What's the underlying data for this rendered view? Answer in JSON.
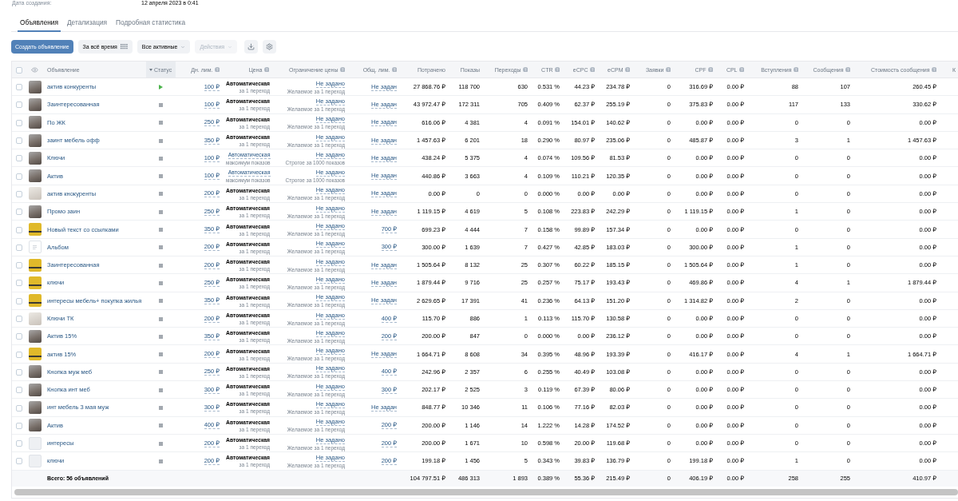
{
  "meta": {
    "label": "Дата создания:",
    "value": "12 апреля 2023 в 0:41"
  },
  "tabs": [
    {
      "label": "Объявления",
      "selected": true
    },
    {
      "label": "Детализация",
      "selected": false
    },
    {
      "label": "Подробная статистика",
      "selected": false
    }
  ],
  "toolbar": {
    "create_button": "Создать объявление",
    "period": "За всё время",
    "filter": "Все активные",
    "actions": {
      "label": "Действия",
      "disabled": true
    }
  },
  "table": {
    "select_all": {
      "checked": false
    },
    "columns": [
      {
        "label": "Объявление",
        "help": false,
        "sorted": false
      },
      {
        "label": "Статус",
        "help": false,
        "sorted": true
      },
      {
        "label": "Дн. лим.",
        "help": true,
        "sorted": false
      },
      {
        "label": "Цена",
        "help": true,
        "sorted": false
      },
      {
        "label": "Ограничение цены",
        "help": true,
        "sorted": false
      },
      {
        "label": "Общ. лим.",
        "help": true,
        "sorted": false
      },
      {
        "label": "Потрачено",
        "help": false,
        "sorted": false
      },
      {
        "label": "Показы",
        "help": false,
        "sorted": false
      },
      {
        "label": "Переходы",
        "help": true,
        "sorted": false
      },
      {
        "label": "CTR",
        "help": true,
        "sorted": false
      },
      {
        "label": "eCPC",
        "help": true,
        "sorted": false
      },
      {
        "label": "eCPM",
        "help": true,
        "sorted": false
      },
      {
        "label": "Заявки",
        "help": true,
        "sorted": false
      },
      {
        "label": "CPF",
        "help": true,
        "sorted": false
      },
      {
        "label": "CPL",
        "help": true,
        "sorted": false
      },
      {
        "label": "Вступления",
        "help": true,
        "sorted": false
      },
      {
        "label": "Сообщения",
        "help": true,
        "sorted": false
      },
      {
        "label": "Стоимость сообщения",
        "help": true,
        "sorted": false
      },
      {
        "label": "К",
        "help": false,
        "sorted": false
      }
    ],
    "rows": [
      {
        "checked": false,
        "thumbnail": {
          "kind": "photo"
        },
        "name": "актив конкуренты",
        "active": true,
        "day_limit": "100 ₽",
        "price": {
          "text": "Автоматическая",
          "note": "за 1 переход",
          "link": false
        },
        "price_limit": {
          "text": "Не задано",
          "note": "Желаемое за 1 переход"
        },
        "total_limit": "Не задан",
        "stats": [
          "27 868.76 ₽",
          "118 700",
          "630",
          "0.531 %",
          "44.23 ₽",
          "234.78 ₽",
          "0",
          "316.69 ₽",
          "0.00 ₽",
          "88",
          "107",
          "260.45 ₽"
        ]
      },
      {
        "checked": false,
        "thumbnail": {
          "kind": "photo"
        },
        "name": "Заинтересованная",
        "active": false,
        "day_limit": "100 ₽",
        "price": {
          "text": "Автоматическая",
          "note": "за 1 переход",
          "link": false
        },
        "price_limit": {
          "text": "Не задано",
          "note": "Желаемое за 1 переход"
        },
        "total_limit": "Не задан",
        "stats": [
          "43 972.47 ₽",
          "172 311",
          "705",
          "0.409 %",
          "62.37 ₽",
          "255.19 ₽",
          "0",
          "375.83 ₽",
          "0.00 ₽",
          "117",
          "133",
          "330.62 ₽"
        ]
      },
      {
        "checked": false,
        "thumbnail": {
          "kind": "photo"
        },
        "name": "По ЖК",
        "active": false,
        "day_limit": "250 ₽",
        "price": {
          "text": "Автоматическая",
          "note": "за 1 переход",
          "link": false
        },
        "price_limit": {
          "text": "Не задано",
          "note": "Желаемое за 1 переход"
        },
        "total_limit": "Не задан",
        "stats": [
          "616.06 ₽",
          "4 381",
          "4",
          "0.091 %",
          "154.01 ₽",
          "140.62 ₽",
          "0",
          "0.00 ₽",
          "0.00 ₽",
          "0",
          "0",
          "0.00 ₽"
        ]
      },
      {
        "checked": false,
        "thumbnail": {
          "kind": "photo"
        },
        "name": "заинт мебель офф",
        "active": false,
        "day_limit": "350 ₽",
        "price": {
          "text": "Автоматическая",
          "note": "за 1 переход",
          "link": false
        },
        "price_limit": {
          "text": "Не задано",
          "note": "Желаемое за 1 переход"
        },
        "total_limit": "Не задан",
        "stats": [
          "1 457.63 ₽",
          "6 201",
          "18",
          "0.290 %",
          "80.97 ₽",
          "235.06 ₽",
          "0",
          "485.87 ₽",
          "0.00 ₽",
          "3",
          "1",
          "1 457.63 ₽"
        ]
      },
      {
        "checked": false,
        "thumbnail": {
          "kind": "photo"
        },
        "name": "Ключи",
        "active": false,
        "day_limit": "100 ₽",
        "price": {
          "text": "Автоматическая",
          "note": "максимум показов",
          "link": true
        },
        "price_limit": {
          "text": "Не задано",
          "note": "Строгое за 1000 показов"
        },
        "total_limit": "Не задан",
        "stats": [
          "438.24 ₽",
          "5 375",
          "4",
          "0.074 %",
          "109.56 ₽",
          "81.53 ₽",
          "0",
          "0.00 ₽",
          "0.00 ₽",
          "0",
          "0",
          "0.00 ₽"
        ]
      },
      {
        "checked": false,
        "thumbnail": {
          "kind": "photo"
        },
        "name": "Актив",
        "active": false,
        "day_limit": "100 ₽",
        "price": {
          "text": "Автоматическая",
          "note": "максимум показов",
          "link": true
        },
        "price_limit": {
          "text": "Не задано",
          "note": "Строгое за 1000 показов"
        },
        "total_limit": "Не задан",
        "stats": [
          "440.86 ₽",
          "3 663",
          "4",
          "0.109 %",
          "110.21 ₽",
          "120.35 ₽",
          "0",
          "0.00 ₽",
          "0.00 ₽",
          "0",
          "0",
          "0.00 ₽"
        ]
      },
      {
        "checked": false,
        "thumbnail": {
          "kind": "sketch"
        },
        "name": "актив кнокуренты",
        "active": false,
        "day_limit": "200 ₽",
        "price": {
          "text": "Автоматическая",
          "note": "за 1 переход",
          "link": false
        },
        "price_limit": {
          "text": "Не задано",
          "note": "Желаемое за 1 переход"
        },
        "total_limit": "Не задан",
        "stats": [
          "0.00 ₽",
          "0",
          "0",
          "0.000 %",
          "0.00 ₽",
          "0.00 ₽",
          "0",
          "0.00 ₽",
          "0.00 ₽",
          "0",
          "0",
          "0.00 ₽"
        ]
      },
      {
        "checked": false,
        "thumbnail": {
          "kind": "photo"
        },
        "name": "Промо заин",
        "active": false,
        "day_limit": "250 ₽",
        "price": {
          "text": "Автоматическая",
          "note": "за 1 переход",
          "link": false
        },
        "price_limit": {
          "text": "Не задано",
          "note": "Желаемое за 1 переход"
        },
        "total_limit": "Не задан",
        "stats": [
          "1 119.15 ₽",
          "4 619",
          "5",
          "0.108 %",
          "223.83 ₽",
          "242.29 ₽",
          "0",
          "1 119.15 ₽",
          "0.00 ₽",
          "1",
          "0",
          "0.00 ₽"
        ]
      },
      {
        "checked": false,
        "thumbnail": {
          "kind": "banner"
        },
        "name": "Новый текст со ссылками",
        "active": false,
        "day_limit": "350 ₽",
        "price": {
          "text": "Автоматическая",
          "note": "за 1 переход",
          "link": false
        },
        "price_limit": {
          "text": "Не задано",
          "note": "Желаемое за 1 переход"
        },
        "total_limit": "700 ₽",
        "stats": [
          "699.23 ₽",
          "4 444",
          "7",
          "0.158 %",
          "99.89 ₽",
          "157.34 ₽",
          "0",
          "0.00 ₽",
          "0.00 ₽",
          "0",
          "0",
          "0.00 ₽"
        ]
      },
      {
        "checked": false,
        "thumbnail": {
          "kind": "document"
        },
        "name": "Альбом",
        "active": false,
        "day_limit": "200 ₽",
        "price": {
          "text": "Автоматическая",
          "note": "за 1 переход",
          "link": false
        },
        "price_limit": {
          "text": "Не задано",
          "note": "Желаемое за 1 переход"
        },
        "total_limit": "300 ₽",
        "stats": [
          "300.00 ₽",
          "1 639",
          "7",
          "0.427 %",
          "42.85 ₽",
          "183.03 ₽",
          "0",
          "300.00 ₽",
          "0.00 ₽",
          "1",
          "0",
          "0.00 ₽"
        ]
      },
      {
        "checked": false,
        "thumbnail": {
          "kind": "banner"
        },
        "name": "Заинтересованная",
        "active": false,
        "day_limit": "200 ₽",
        "price": {
          "text": "Автоматическая",
          "note": "за 1 переход",
          "link": false
        },
        "price_limit": {
          "text": "Не задано",
          "note": "Желаемое за 1 переход"
        },
        "total_limit": "Не задан",
        "stats": [
          "1 505.64 ₽",
          "8 132",
          "25",
          "0.307 %",
          "60.22 ₽",
          "185.15 ₽",
          "0",
          "1 505.64 ₽",
          "0.00 ₽",
          "1",
          "0",
          "0.00 ₽"
        ]
      },
      {
        "checked": false,
        "thumbnail": {
          "kind": "banner"
        },
        "name": "ключи",
        "active": false,
        "day_limit": "250 ₽",
        "price": {
          "text": "Автоматическая",
          "note": "за 1 переход",
          "link": false
        },
        "price_limit": {
          "text": "Не задано",
          "note": "Желаемое за 1 переход"
        },
        "total_limit": "Не задан",
        "stats": [
          "1 879.44 ₽",
          "9 716",
          "25",
          "0.257 %",
          "75.17 ₽",
          "193.43 ₽",
          "0",
          "469.86 ₽",
          "0.00 ₽",
          "4",
          "1",
          "1 879.44 ₽"
        ]
      },
      {
        "checked": false,
        "thumbnail": {
          "kind": "banner"
        },
        "name": "интересы мебель+ покупка жилья",
        "active": false,
        "day_limit": "350 ₽",
        "price": {
          "text": "Автоматическая",
          "note": "за 1 переход",
          "link": false
        },
        "price_limit": {
          "text": "Не задано",
          "note": "Желаемое за 1 переход"
        },
        "total_limit": "Не задан",
        "stats": [
          "2 629.65 ₽",
          "17 391",
          "41",
          "0.236 %",
          "64.13 ₽",
          "151.20 ₽",
          "0",
          "1 314.82 ₽",
          "0.00 ₽",
          "2",
          "0",
          "0.00 ₽"
        ]
      },
      {
        "checked": false,
        "thumbnail": {
          "kind": "sketch"
        },
        "name": "Ключи ТК",
        "active": false,
        "day_limit": "200 ₽",
        "price": {
          "text": "Автоматическая",
          "note": "за 1 переход",
          "link": false
        },
        "price_limit": {
          "text": "Не задано",
          "note": "Желаемое за 1 переход"
        },
        "total_limit": "400 ₽",
        "stats": [
          "115.70 ₽",
          "886",
          "1",
          "0.113 %",
          "115.70 ₽",
          "130.58 ₽",
          "0",
          "0.00 ₽",
          "0.00 ₽",
          "0",
          "0",
          "0.00 ₽"
        ]
      },
      {
        "checked": false,
        "thumbnail": {
          "kind": "photo"
        },
        "name": "Актив 15%",
        "active": false,
        "day_limit": "350 ₽",
        "price": {
          "text": "Автоматическая",
          "note": "за 1 переход",
          "link": false
        },
        "price_limit": {
          "text": "Не задано",
          "note": "Желаемое за 1 переход"
        },
        "total_limit": "200 ₽",
        "stats": [
          "200.00 ₽",
          "847",
          "0",
          "0.000 %",
          "0.00 ₽",
          "236.12 ₽",
          "0",
          "0.00 ₽",
          "0.00 ₽",
          "0",
          "0",
          "0.00 ₽"
        ]
      },
      {
        "checked": false,
        "thumbnail": {
          "kind": "banner"
        },
        "name": "актив 15%",
        "active": false,
        "day_limit": "200 ₽",
        "price": {
          "text": "Автоматическая",
          "note": "за 1 переход",
          "link": false
        },
        "price_limit": {
          "text": "Не задано",
          "note": "Желаемое за 1 переход"
        },
        "total_limit": "Не задан",
        "stats": [
          "1 664.71 ₽",
          "8 608",
          "34",
          "0.395 %",
          "48.96 ₽",
          "193.39 ₽",
          "0",
          "416.17 ₽",
          "0.00 ₽",
          "4",
          "1",
          "1 664.71 ₽"
        ]
      },
      {
        "checked": false,
        "thumbnail": {
          "kind": "photo"
        },
        "name": "Кнопка муж меб",
        "active": false,
        "day_limit": "250 ₽",
        "price": {
          "text": "Автоматическая",
          "note": "за 1 переход",
          "link": false
        },
        "price_limit": {
          "text": "Не задано",
          "note": "Желаемое за 1 переход"
        },
        "total_limit": "400 ₽",
        "stats": [
          "242.96 ₽",
          "2 357",
          "6",
          "0.255 %",
          "40.49 ₽",
          "103.08 ₽",
          "0",
          "0.00 ₽",
          "0.00 ₽",
          "0",
          "0",
          "0.00 ₽"
        ]
      },
      {
        "checked": false,
        "thumbnail": {
          "kind": "photo"
        },
        "name": "Кнопка инт меб",
        "active": false,
        "day_limit": "300 ₽",
        "price": {
          "text": "Автоматическая",
          "note": "за 1 переход",
          "link": false
        },
        "price_limit": {
          "text": "Не задано",
          "note": "Желаемое за 1 переход"
        },
        "total_limit": "300 ₽",
        "stats": [
          "202.17 ₽",
          "2 525",
          "3",
          "0.119 %",
          "67.39 ₽",
          "80.06 ₽",
          "0",
          "0.00 ₽",
          "0.00 ₽",
          "0",
          "0",
          "0.00 ₽"
        ]
      },
      {
        "checked": false,
        "thumbnail": {
          "kind": "photo"
        },
        "name": "инт мебель 3 мая муж",
        "active": false,
        "day_limit": "300 ₽",
        "price": {
          "text": "Автоматическая",
          "note": "за 1 переход",
          "link": false
        },
        "price_limit": {
          "text": "Не задано",
          "note": "Желаемое за 1 переход"
        },
        "total_limit": "Не задан",
        "stats": [
          "848.77 ₽",
          "10 346",
          "11",
          "0.106 %",
          "77.16 ₽",
          "82.03 ₽",
          "0",
          "0.00 ₽",
          "0.00 ₽",
          "0",
          "0",
          "0.00 ₽"
        ]
      },
      {
        "checked": false,
        "thumbnail": {
          "kind": "photo"
        },
        "name": "Актив",
        "active": false,
        "day_limit": "400 ₽",
        "price": {
          "text": "Автоматическая",
          "note": "за 1 переход",
          "link": false
        },
        "price_limit": {
          "text": "Не задано",
          "note": "Желаемое за 1 переход"
        },
        "total_limit": "200 ₽",
        "stats": [
          "200.00 ₽",
          "1 146",
          "14",
          "1.222 %",
          "14.28 ₽",
          "174.52 ₽",
          "0",
          "0.00 ₽",
          "0.00 ₽",
          "0",
          "0",
          "0.00 ₽"
        ]
      },
      {
        "checked": false,
        "thumbnail": {
          "kind": "empty"
        },
        "name": "интересы",
        "active": false,
        "day_limit": "200 ₽",
        "price": {
          "text": "Автоматическая",
          "note": "за 1 переход",
          "link": false
        },
        "price_limit": {
          "text": "Не задано",
          "note": "Желаемое за 1 переход"
        },
        "total_limit": "200 ₽",
        "stats": [
          "200.00 ₽",
          "1 671",
          "10",
          "0.598 %",
          "20.00 ₽",
          "119.68 ₽",
          "0",
          "0.00 ₽",
          "0.00 ₽",
          "0",
          "0",
          "0.00 ₽"
        ]
      },
      {
        "checked": false,
        "thumbnail": {
          "kind": "empty"
        },
        "name": "ключи",
        "active": false,
        "day_limit": "200 ₽",
        "price": {
          "text": "Автоматическая",
          "note": "за 1 переход",
          "link": false
        },
        "price_limit": {
          "text": "Не задано",
          "note": "Желаемое за 1 переход"
        },
        "total_limit": "200 ₽",
        "stats": [
          "199.18 ₽",
          "1 456",
          "5",
          "0.343 %",
          "39.83 ₽",
          "136.79 ₽",
          "0",
          "199.18 ₽",
          "0.00 ₽",
          "1",
          "0",
          "0.00 ₽"
        ]
      }
    ],
    "footer": {
      "label": "Всего: 56 объявлений",
      "totals": [
        "104 797.51 ₽",
        "486 313",
        "1 893",
        "0.389 %",
        "55.36 ₽",
        "215.49 ₽",
        "0",
        "406.19 ₽",
        "0.00 ₽",
        "258",
        "255",
        "410.97 ₽"
      ]
    }
  }
}
